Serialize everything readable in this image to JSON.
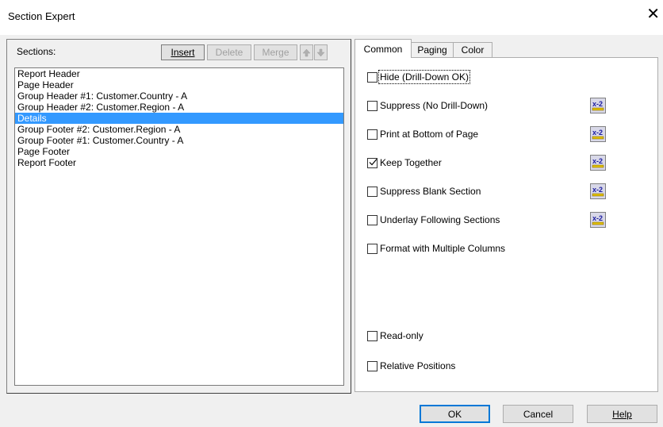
{
  "window": {
    "title": "Section Expert",
    "close_glyph": "✕"
  },
  "sections_panel": {
    "label": "Sections:",
    "buttons": {
      "insert": "Insert",
      "delete": "Delete",
      "merge": "Merge"
    },
    "items": [
      "Report Header",
      "Page Header",
      "Group Header #1: Customer.Country - A",
      "Group Header #2: Customer.Region - A",
      "Details",
      "Group Footer #2: Customer.Region - A",
      "Group Footer #1: Customer.Country - A",
      "Page Footer",
      "Report Footer"
    ],
    "selected_index": 4
  },
  "tabs": [
    "Common",
    "Paging",
    "Color"
  ],
  "active_tab": "Common",
  "options": {
    "hide": "Hide (Drill-Down OK)",
    "suppress": "Suppress (No Drill-Down)",
    "print_bottom": "Print at Bottom of Page",
    "keep_together": "Keep Together",
    "suppress_blank": "Suppress Blank Section",
    "underlay": "Underlay Following Sections",
    "multiple_columns": "Format with Multiple Columns",
    "read_only": "Read-only",
    "relative_positions": "Relative Positions"
  },
  "formula_icon_label": "x-2",
  "footer_buttons": {
    "ok": "OK",
    "cancel": "Cancel",
    "help": "Help"
  },
  "colors": {
    "selection": "#3399ff",
    "default_button_border": "#0078d7"
  }
}
